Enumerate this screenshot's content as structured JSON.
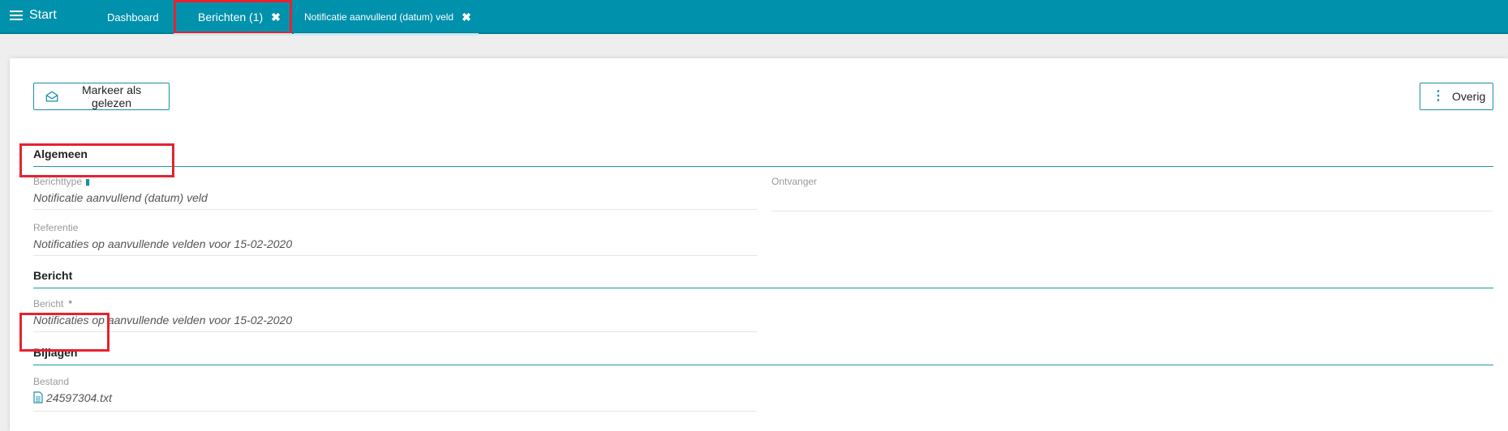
{
  "topbar": {
    "start_label": "Start",
    "tabs": [
      {
        "label": "Dashboard",
        "close": ""
      },
      {
        "label": "Berichten (1)",
        "close": "✖"
      },
      {
        "label": "Notificatie aanvullend (datum) veld",
        "close": "✖"
      }
    ]
  },
  "toolbar": {
    "mark_read_label": "Markeer als gelezen",
    "more_label": "Overig"
  },
  "sections": {
    "algemeen": "Algemeen",
    "bericht": "Bericht",
    "bijlagen": "Bijlagen"
  },
  "fields": {
    "berichttype": {
      "label": "Berichttype",
      "value": "Notificatie aanvullend (datum) veld"
    },
    "ontvanger": {
      "label": "Ontvanger",
      "value": ""
    },
    "referentie": {
      "label": "Referentie",
      "value": "Notificaties op aanvullende velden voor 15-02-2020"
    },
    "bericht": {
      "label": "Bericht",
      "required_mark": "*",
      "value": "Notificaties op aanvullende velden voor 15-02-2020"
    },
    "bestand": {
      "label": "Bestand",
      "value": "24597304.txt"
    }
  },
  "colors": {
    "topbar": "#0091ad",
    "accent": "#1a8fa6",
    "highlight": "#e52330"
  }
}
